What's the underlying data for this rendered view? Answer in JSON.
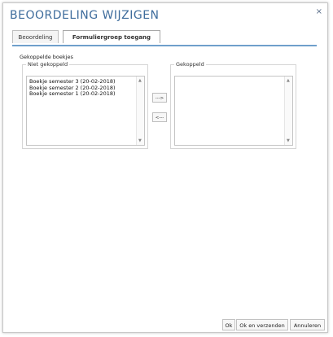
{
  "dialog": {
    "title": "BEOORDELING WIJZIGEN",
    "close_label": "×"
  },
  "tabs": [
    {
      "label": "Beoordeling"
    },
    {
      "label": "Formuliergroep toegang"
    }
  ],
  "section": {
    "label": "Gekoppelde boekjes"
  },
  "left_list": {
    "legend": "Niet gekoppeld",
    "items": [
      "Boekje semester 3 (20-02-2018)",
      "Boekje semester 2 (20-02-2018)",
      "Boekje semester 1 (20-02-2018)"
    ]
  },
  "right_list": {
    "legend": "Gekoppeld",
    "items": []
  },
  "move_buttons": {
    "to_right": "--->",
    "to_left": "<---"
  },
  "footer": {
    "ok": "Ok",
    "ok_send": "Ok en verzenden",
    "cancel": "Annuleren"
  },
  "colors": {
    "title": "#3e6c9c",
    "tab_underline": "#6f9fcb"
  }
}
